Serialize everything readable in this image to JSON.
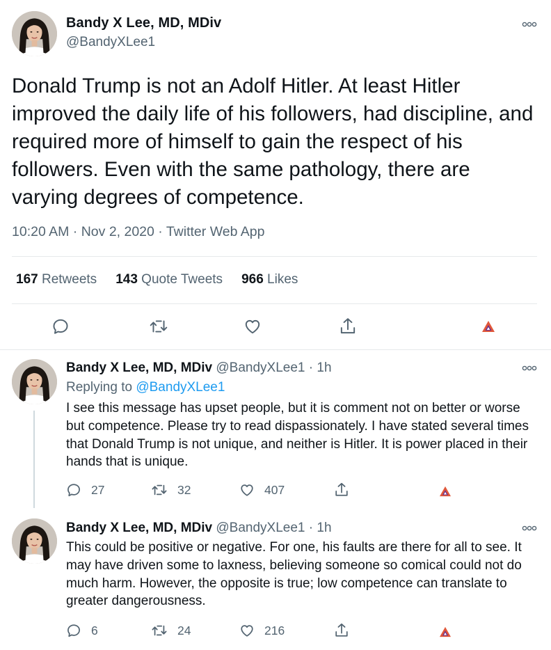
{
  "main_tweet": {
    "display_name": "Bandy X Lee, MD, MDiv",
    "handle": "@BandyXLee1",
    "text": "Donald Trump is not an Adolf Hitler.  At least Hitler improved the daily life of his followers, had discipline, and required more of himself to gain the respect of his followers.  Even with the same pathology, there are varying degrees of competence.",
    "meta": "10:20 AM · Nov 2, 2020 · Twitter Web App",
    "stats": {
      "retweets_count": "167",
      "retweets_label": "Retweets",
      "quotes_count": "143",
      "quotes_label": "Quote Tweets",
      "likes_count": "966",
      "likes_label": "Likes"
    },
    "icons": [
      "reply-icon",
      "retweet-icon",
      "like-icon",
      "share-icon",
      "brave-tip-icon",
      "more-icon"
    ]
  },
  "replies": [
    {
      "display_name": "Bandy X Lee, MD, MDiv",
      "handle_time": "@BandyXLee1 · 1h",
      "replying_prefix": "Replying to",
      "replying_handle": "@BandyXLee1",
      "text": "I see this message has upset people, but it is comment not on better or worse but competence.  Please try to read dispassionately.  I have stated several times that Donald Trump is not unique, and neither is Hitler.  It is power placed in their hands that is unique.",
      "reply_count": "27",
      "retweet_count": "32",
      "like_count": "407"
    },
    {
      "display_name": "Bandy X Lee, MD, MDiv",
      "handle_time": "@BandyXLee1 · 1h",
      "text": "This could be positive or negative.  For one, his faults are there for all to see.  It may have driven some to laxness, believing someone so comical could not do much harm.  However, the opposite is true; low competence can translate to greater dangerousness.",
      "reply_count": "6",
      "retweet_count": "24",
      "like_count": "216"
    }
  ],
  "colors": {
    "text": "#0f1419",
    "secondary": "#536471",
    "link": "#1d9bf0",
    "brave_red": "#e0573a",
    "brave_purple": "#662d91"
  }
}
